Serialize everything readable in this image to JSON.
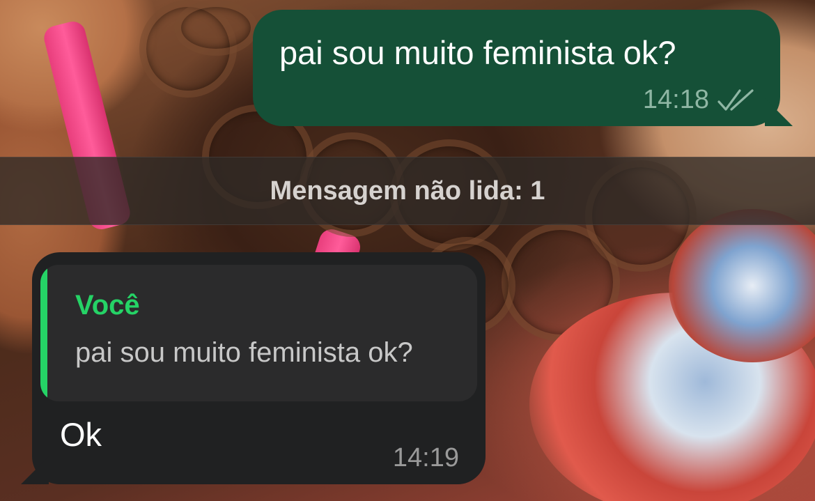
{
  "colors": {
    "outgoing_bubble": "#155037",
    "incoming_bubble": "#202122",
    "quote_accent": "#25d366",
    "timestamp_out": "#8fb6a4",
    "timestamp_in": "#9a9a9a"
  },
  "messages": [
    {
      "direction": "outgoing",
      "text": "pai sou muito feminista ok?",
      "time": "14:18",
      "status_icon": "double-check-icon"
    },
    {
      "direction": "incoming",
      "reply_to": {
        "author": "Você",
        "text": "pai sou muito feminista ok?"
      },
      "text": "Ok",
      "time": "14:19"
    }
  ],
  "unread_divider": {
    "label": "Mensagem não lida: 1"
  }
}
